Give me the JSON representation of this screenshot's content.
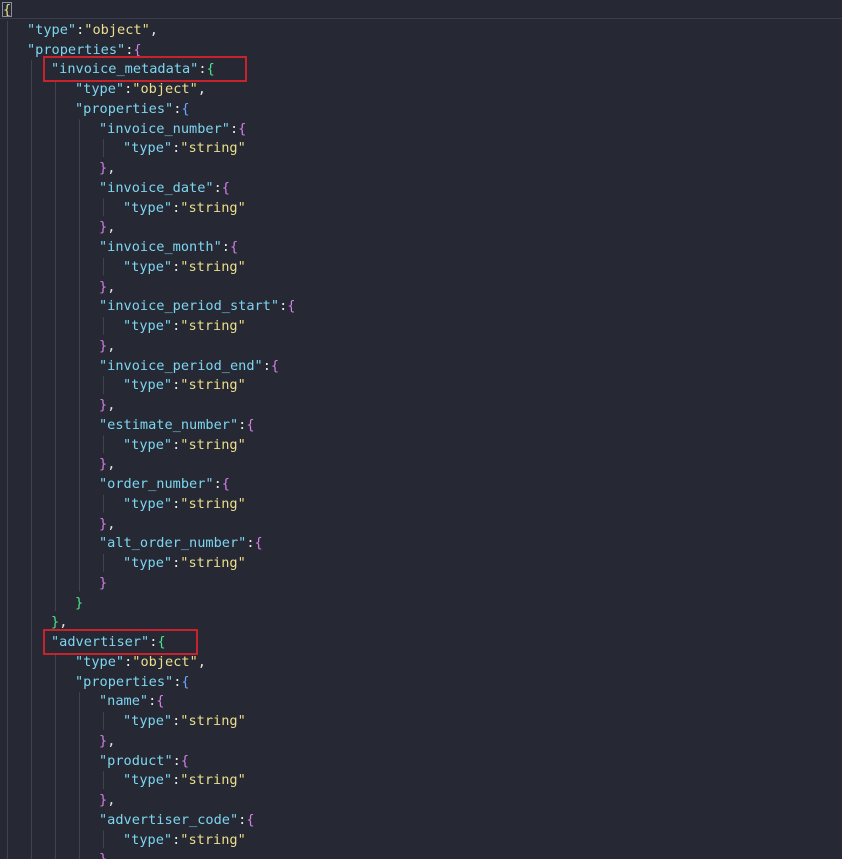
{
  "editor": {
    "colors": {
      "background": "#262834",
      "key": "#7dd6f0",
      "string": "#ecdf8c",
      "punctuation": "#e8e8e8",
      "bracket_depth_0": "#ecdf8c",
      "bracket_depth_1": "#d27fe6",
      "bracket_depth_2": "#4fe38a",
      "bracket_depth_3": "#69a6ff",
      "indent_guide": "#41444f",
      "highlight_box": "#c8232c"
    },
    "highlighted_keys": [
      "invoice_metadata",
      "advertiser"
    ],
    "lines": [
      {
        "indent": 0,
        "tokens": [
          {
            "t": "{",
            "c": "b0"
          }
        ]
      },
      {
        "indent": 1,
        "tokens": [
          {
            "t": "\"type\"",
            "c": "key"
          },
          {
            "t": ":",
            "c": "punct"
          },
          {
            "t": "\"object\"",
            "c": "str"
          },
          {
            "t": ",",
            "c": "punct"
          }
        ]
      },
      {
        "indent": 1,
        "tokens": [
          {
            "t": "\"properties\"",
            "c": "key"
          },
          {
            "t": ":",
            "c": "punct"
          },
          {
            "t": "{",
            "c": "b1"
          }
        ]
      },
      {
        "indent": 2,
        "tokens": [
          {
            "t": "\"invoice_metadata\"",
            "c": "key"
          },
          {
            "t": ":",
            "c": "punct"
          },
          {
            "t": "{",
            "c": "b2"
          }
        ]
      },
      {
        "indent": 3,
        "tokens": [
          {
            "t": "\"type\"",
            "c": "key"
          },
          {
            "t": ":",
            "c": "punct"
          },
          {
            "t": "\"object\"",
            "c": "str"
          },
          {
            "t": ",",
            "c": "punct"
          }
        ]
      },
      {
        "indent": 3,
        "tokens": [
          {
            "t": "\"properties\"",
            "c": "key"
          },
          {
            "t": ":",
            "c": "punct"
          },
          {
            "t": "{",
            "c": "b3"
          }
        ]
      },
      {
        "indent": 4,
        "tokens": [
          {
            "t": "\"invoice_number\"",
            "c": "key"
          },
          {
            "t": ":",
            "c": "punct"
          },
          {
            "t": "{",
            "c": "b1"
          }
        ]
      },
      {
        "indent": 5,
        "tokens": [
          {
            "t": "\"type\"",
            "c": "key"
          },
          {
            "t": ":",
            "c": "punct"
          },
          {
            "t": "\"string\"",
            "c": "str"
          }
        ]
      },
      {
        "indent": 4,
        "tokens": [
          {
            "t": "}",
            "c": "b1"
          },
          {
            "t": ",",
            "c": "punct"
          }
        ]
      },
      {
        "indent": 4,
        "tokens": [
          {
            "t": "\"invoice_date\"",
            "c": "key"
          },
          {
            "t": ":",
            "c": "punct"
          },
          {
            "t": "{",
            "c": "b1"
          }
        ]
      },
      {
        "indent": 5,
        "tokens": [
          {
            "t": "\"type\"",
            "c": "key"
          },
          {
            "t": ":",
            "c": "punct"
          },
          {
            "t": "\"string\"",
            "c": "str"
          }
        ]
      },
      {
        "indent": 4,
        "tokens": [
          {
            "t": "}",
            "c": "b1"
          },
          {
            "t": ",",
            "c": "punct"
          }
        ]
      },
      {
        "indent": 4,
        "tokens": [
          {
            "t": "\"invoice_month\"",
            "c": "key"
          },
          {
            "t": ":",
            "c": "punct"
          },
          {
            "t": "{",
            "c": "b1"
          }
        ]
      },
      {
        "indent": 5,
        "tokens": [
          {
            "t": "\"type\"",
            "c": "key"
          },
          {
            "t": ":",
            "c": "punct"
          },
          {
            "t": "\"string\"",
            "c": "str"
          }
        ]
      },
      {
        "indent": 4,
        "tokens": [
          {
            "t": "}",
            "c": "b1"
          },
          {
            "t": ",",
            "c": "punct"
          }
        ]
      },
      {
        "indent": 4,
        "tokens": [
          {
            "t": "\"invoice_period_start\"",
            "c": "key"
          },
          {
            "t": ":",
            "c": "punct"
          },
          {
            "t": "{",
            "c": "b1"
          }
        ]
      },
      {
        "indent": 5,
        "tokens": [
          {
            "t": "\"type\"",
            "c": "key"
          },
          {
            "t": ":",
            "c": "punct"
          },
          {
            "t": "\"string\"",
            "c": "str"
          }
        ]
      },
      {
        "indent": 4,
        "tokens": [
          {
            "t": "}",
            "c": "b1"
          },
          {
            "t": ",",
            "c": "punct"
          }
        ]
      },
      {
        "indent": 4,
        "tokens": [
          {
            "t": "\"invoice_period_end\"",
            "c": "key"
          },
          {
            "t": ":",
            "c": "punct"
          },
          {
            "t": "{",
            "c": "b1"
          }
        ]
      },
      {
        "indent": 5,
        "tokens": [
          {
            "t": "\"type\"",
            "c": "key"
          },
          {
            "t": ":",
            "c": "punct"
          },
          {
            "t": "\"string\"",
            "c": "str"
          }
        ]
      },
      {
        "indent": 4,
        "tokens": [
          {
            "t": "}",
            "c": "b1"
          },
          {
            "t": ",",
            "c": "punct"
          }
        ]
      },
      {
        "indent": 4,
        "tokens": [
          {
            "t": "\"estimate_number\"",
            "c": "key"
          },
          {
            "t": ":",
            "c": "punct"
          },
          {
            "t": "{",
            "c": "b1"
          }
        ]
      },
      {
        "indent": 5,
        "tokens": [
          {
            "t": "\"type\"",
            "c": "key"
          },
          {
            "t": ":",
            "c": "punct"
          },
          {
            "t": "\"string\"",
            "c": "str"
          }
        ]
      },
      {
        "indent": 4,
        "tokens": [
          {
            "t": "}",
            "c": "b1"
          },
          {
            "t": ",",
            "c": "punct"
          }
        ]
      },
      {
        "indent": 4,
        "tokens": [
          {
            "t": "\"order_number\"",
            "c": "key"
          },
          {
            "t": ":",
            "c": "punct"
          },
          {
            "t": "{",
            "c": "b1"
          }
        ]
      },
      {
        "indent": 5,
        "tokens": [
          {
            "t": "\"type\"",
            "c": "key"
          },
          {
            "t": ":",
            "c": "punct"
          },
          {
            "t": "\"string\"",
            "c": "str"
          }
        ]
      },
      {
        "indent": 4,
        "tokens": [
          {
            "t": "}",
            "c": "b1"
          },
          {
            "t": ",",
            "c": "punct"
          }
        ]
      },
      {
        "indent": 4,
        "tokens": [
          {
            "t": "\"alt_order_number\"",
            "c": "key"
          },
          {
            "t": ":",
            "c": "punct"
          },
          {
            "t": "{",
            "c": "b1"
          }
        ]
      },
      {
        "indent": 5,
        "tokens": [
          {
            "t": "\"type\"",
            "c": "key"
          },
          {
            "t": ":",
            "c": "punct"
          },
          {
            "t": "\"string\"",
            "c": "str"
          }
        ]
      },
      {
        "indent": 4,
        "tokens": [
          {
            "t": "}",
            "c": "b1"
          }
        ]
      },
      {
        "indent": 3,
        "tokens": [
          {
            "t": "}",
            "c": "b2"
          }
        ]
      },
      {
        "indent": 2,
        "tokens": [
          {
            "t": "}",
            "c": "b2"
          },
          {
            "t": ",",
            "c": "punct"
          }
        ]
      },
      {
        "indent": 2,
        "tokens": [
          {
            "t": "\"advertiser\"",
            "c": "key"
          },
          {
            "t": ":",
            "c": "punct"
          },
          {
            "t": "{",
            "c": "b2"
          }
        ]
      },
      {
        "indent": 3,
        "tokens": [
          {
            "t": "\"type\"",
            "c": "key"
          },
          {
            "t": ":",
            "c": "punct"
          },
          {
            "t": "\"object\"",
            "c": "str"
          },
          {
            "t": ",",
            "c": "punct"
          }
        ]
      },
      {
        "indent": 3,
        "tokens": [
          {
            "t": "\"properties\"",
            "c": "key"
          },
          {
            "t": ":",
            "c": "punct"
          },
          {
            "t": "{",
            "c": "b3"
          }
        ]
      },
      {
        "indent": 4,
        "tokens": [
          {
            "t": "\"name\"",
            "c": "key"
          },
          {
            "t": ":",
            "c": "punct"
          },
          {
            "t": "{",
            "c": "b1"
          }
        ]
      },
      {
        "indent": 5,
        "tokens": [
          {
            "t": "\"type\"",
            "c": "key"
          },
          {
            "t": ":",
            "c": "punct"
          },
          {
            "t": "\"string\"",
            "c": "str"
          }
        ]
      },
      {
        "indent": 4,
        "tokens": [
          {
            "t": "}",
            "c": "b1"
          },
          {
            "t": ",",
            "c": "punct"
          }
        ]
      },
      {
        "indent": 4,
        "tokens": [
          {
            "t": "\"product\"",
            "c": "key"
          },
          {
            "t": ":",
            "c": "punct"
          },
          {
            "t": "{",
            "c": "b1"
          }
        ]
      },
      {
        "indent": 5,
        "tokens": [
          {
            "t": "\"type\"",
            "c": "key"
          },
          {
            "t": ":",
            "c": "punct"
          },
          {
            "t": "\"string\"",
            "c": "str"
          }
        ]
      },
      {
        "indent": 4,
        "tokens": [
          {
            "t": "}",
            "c": "b1"
          },
          {
            "t": ",",
            "c": "punct"
          }
        ]
      },
      {
        "indent": 4,
        "tokens": [
          {
            "t": "\"advertiser_code\"",
            "c": "key"
          },
          {
            "t": ":",
            "c": "punct"
          },
          {
            "t": "{",
            "c": "b1"
          }
        ]
      },
      {
        "indent": 5,
        "tokens": [
          {
            "t": "\"type\"",
            "c": "key"
          },
          {
            "t": ":",
            "c": "punct"
          },
          {
            "t": "\"string\"",
            "c": "str"
          }
        ]
      },
      {
        "indent": 4,
        "tokens": [
          {
            "t": "}",
            "c": "b1"
          }
        ]
      }
    ]
  }
}
